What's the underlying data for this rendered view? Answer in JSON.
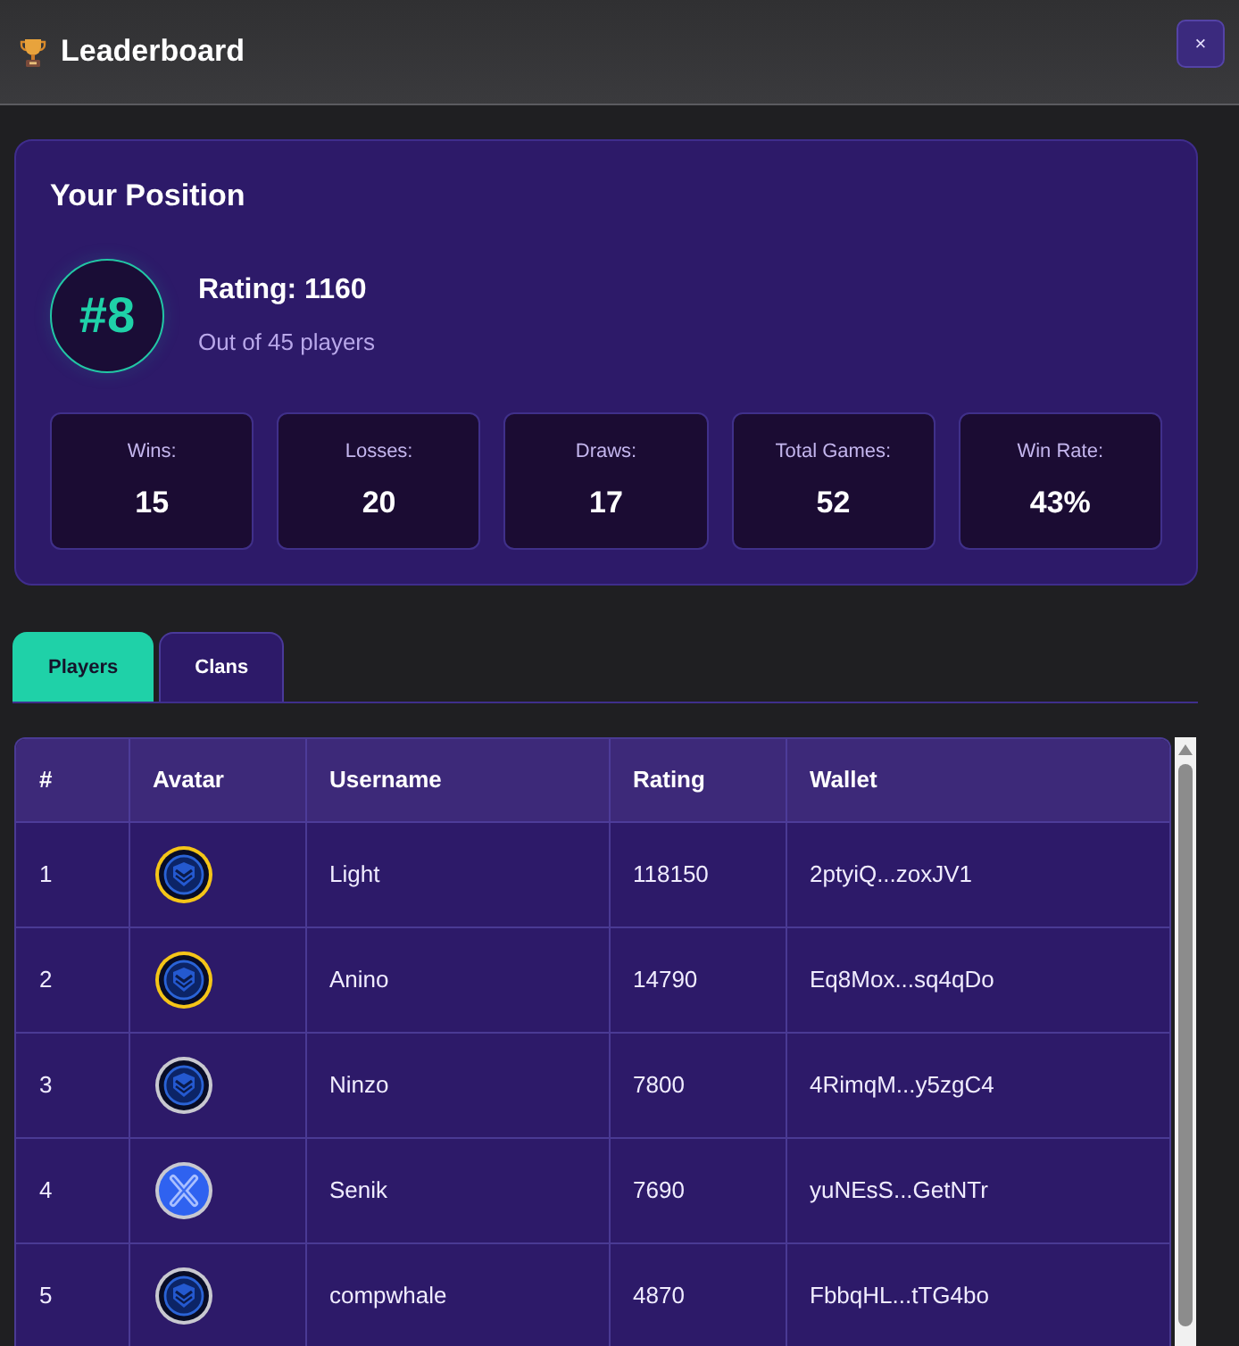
{
  "header": {
    "title": "Leaderboard",
    "close_label": "×"
  },
  "position": {
    "heading": "Your Position",
    "rank": "#8",
    "rating": "Rating: 1160",
    "subtitle": "Out of 45 players",
    "stats": [
      {
        "label": "Wins:",
        "value": "15"
      },
      {
        "label": "Losses:",
        "value": "20"
      },
      {
        "label": "Draws:",
        "value": "17"
      },
      {
        "label": "Total Games:",
        "value": "52"
      },
      {
        "label": "Win Rate:",
        "value": "43%"
      }
    ]
  },
  "tabs": [
    {
      "label": "Players",
      "selected": true
    },
    {
      "label": "Clans",
      "selected": false
    }
  ],
  "table": {
    "columns": [
      "#",
      "Avatar",
      "Username",
      "Rating",
      "Wallet"
    ],
    "rows": [
      {
        "rank": "1",
        "avatar": {
          "kind": "shield",
          "color": "#f5c518"
        },
        "username": "Light",
        "rating": "118150",
        "wallet": "2ptyiQ...zoxJV1"
      },
      {
        "rank": "2",
        "avatar": {
          "kind": "shield",
          "color": "#f5c518"
        },
        "username": "Anino",
        "rating": "14790",
        "wallet": "Eq8Mox...sq4qDo"
      },
      {
        "rank": "3",
        "avatar": {
          "kind": "shield",
          "color": "#c8c8d0"
        },
        "username": "Ninzo",
        "rating": "7800",
        "wallet": "4RimqM...y5zgC4"
      },
      {
        "rank": "4",
        "avatar": {
          "kind": "x",
          "color": "#c8c8d0"
        },
        "username": "Senik",
        "rating": "7690",
        "wallet": "yuNEsS...GetNTr"
      },
      {
        "rank": "5",
        "avatar": {
          "kind": "shield",
          "color": "#c8c8d0"
        },
        "username": "compwhale",
        "rating": "4870",
        "wallet": "FbbqHL...tTG4bo"
      }
    ]
  }
}
